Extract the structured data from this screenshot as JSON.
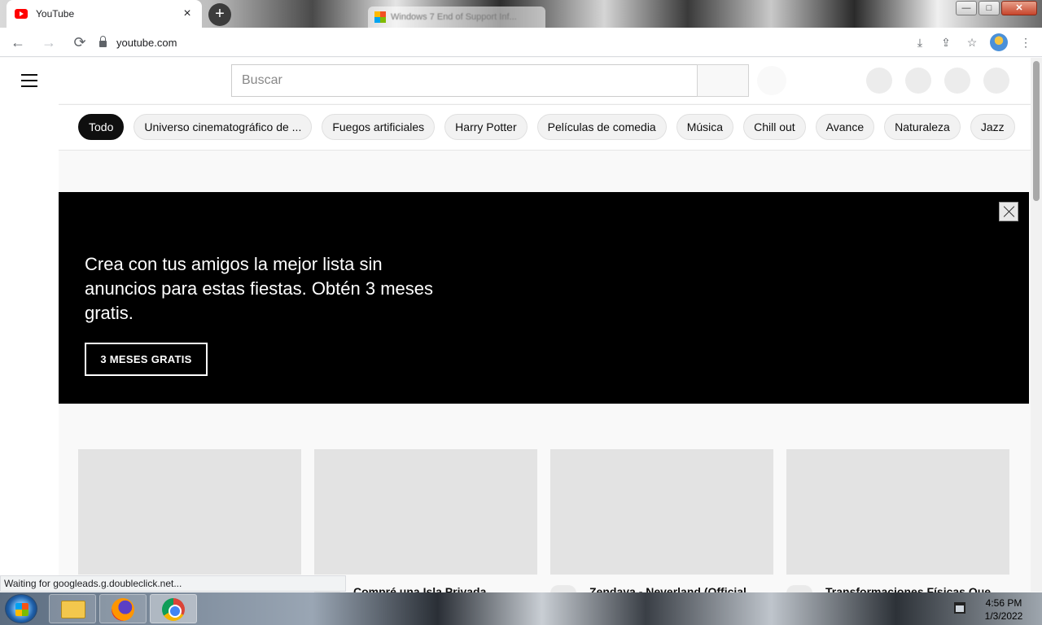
{
  "browser": {
    "tab_title": "YouTube",
    "tab_close": "×",
    "new_tab": "+",
    "ghost_tab_title": "Windows 7 End of Support Inf...",
    "url": "youtube.com",
    "back": "←",
    "forward": "→",
    "reload": "⟳",
    "toolbar_icons": {
      "download": "⤓",
      "share": "⇪",
      "bookmark": "☆",
      "menu": "⋮"
    },
    "window_controls": {
      "minimize": "—",
      "maximize": "□",
      "close": "✕"
    },
    "status_text": "Waiting for googleads.g.doubleclick.net..."
  },
  "youtube": {
    "search_placeholder": "Buscar",
    "chips": [
      {
        "label": "Todo"
      },
      {
        "label": "Universo cinematográfico de ..."
      },
      {
        "label": "Fuegos artificiales"
      },
      {
        "label": "Harry Potter"
      },
      {
        "label": "Películas de comedia"
      },
      {
        "label": "Música"
      },
      {
        "label": "Chill out"
      },
      {
        "label": "Avance"
      },
      {
        "label": "Naturaleza"
      },
      {
        "label": "Jazz"
      }
    ],
    "banner": {
      "text": "Crea con tus amigos la mejor lista sin anuncios para estas fiestas. Obtén 3 meses gratis.",
      "button": "3 MESES GRATIS"
    },
    "videos": [
      {
        "title": ""
      },
      {
        "title": "Compré una Isla Privada"
      },
      {
        "title": "Zendaya - Neverland (Official"
      },
      {
        "title": "Transformaciones Físicas Que"
      }
    ]
  },
  "taskbar": {
    "time": "4:56 PM",
    "date": "1/3/2022"
  },
  "colors": {
    "chip_active": "#0f0f0f",
    "banner_bg": "#000000",
    "thumb_placeholder": "#e3e3e3"
  }
}
